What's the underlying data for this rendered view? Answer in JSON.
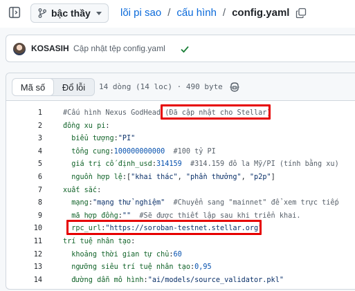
{
  "header": {
    "branch_label": "bậc thầy",
    "breadcrumb": [
      {
        "label": "lõi pi sao"
      },
      {
        "label": "cấu hình"
      }
    ],
    "separator": "/",
    "file_name": "config.yaml"
  },
  "commit": {
    "author": "KOSASIH",
    "message": "Cập nhật tệp config.yaml",
    "status": "success"
  },
  "file": {
    "tabs": [
      "Mã số",
      "Đổ lỗi"
    ],
    "active_tab": "Mã số",
    "info": "14 dòng (14 loc) · 490 byte"
  },
  "code": [
    {
      "n": "1",
      "parts": [
        {
          "t": "#Cấu hình Nexus GodHead ",
          "c": "c"
        },
        {
          "t": "(Đã cập nhật cho Stellar)",
          "c": "c"
        }
      ]
    },
    {
      "n": "2",
      "parts": [
        {
          "t": "đồng xu pi",
          "c": "k"
        },
        {
          "t": ":",
          "c": "p"
        }
      ]
    },
    {
      "n": "3",
      "parts": [
        {
          "t": "  biểu tượng",
          "c": "k"
        },
        {
          "t": ":",
          "c": "p"
        },
        {
          "t": "\"PI\"",
          "c": "s"
        }
      ]
    },
    {
      "n": "4",
      "parts": [
        {
          "t": "  tổng cung",
          "c": "k"
        },
        {
          "t": ":",
          "c": "p"
        },
        {
          "t": "100000000000",
          "c": "n"
        },
        {
          "t": "  #100 tỷ PI",
          "c": "c"
        }
      ]
    },
    {
      "n": "5",
      "parts": [
        {
          "t": "  giá trị cố định_usd",
          "c": "k"
        },
        {
          "t": ":",
          "c": "p"
        },
        {
          "t": "314159",
          "c": "n"
        },
        {
          "t": "  #314.159 đô la Mỹ/PI (tính bằng xu)",
          "c": "c"
        }
      ]
    },
    {
      "n": "6",
      "parts": [
        {
          "t": "  nguồn hợp lệ",
          "c": "k"
        },
        {
          "t": ":[",
          "c": "p"
        },
        {
          "t": "\"khai thác\"",
          "c": "s"
        },
        {
          "t": ", ",
          "c": "p"
        },
        {
          "t": "\"phần thưởng\"",
          "c": "s"
        },
        {
          "t": ", ",
          "c": "p"
        },
        {
          "t": "\"p2p\"",
          "c": "s"
        },
        {
          "t": "]",
          "c": "p"
        }
      ]
    },
    {
      "n": "7",
      "parts": [
        {
          "t": "xuất sắc",
          "c": "k"
        },
        {
          "t": ":",
          "c": "p"
        }
      ]
    },
    {
      "n": "8",
      "parts": [
        {
          "t": "  mạng",
          "c": "k"
        },
        {
          "t": ":",
          "c": "p"
        },
        {
          "t": "\"mạng thử nghiệm\"",
          "c": "s"
        },
        {
          "t": "  #Chuyển sang \"mainnet\" để xem trực tiếp",
          "c": "c"
        }
      ]
    },
    {
      "n": "9",
      "parts": [
        {
          "t": "  mã hợp đồng",
          "c": "k"
        },
        {
          "t": ":",
          "c": "p"
        },
        {
          "t": "\"\"",
          "c": "s"
        },
        {
          "t": "  #Sẽ được thiết lập sau khi triển khai.",
          "c": "c"
        }
      ]
    },
    {
      "n": "10",
      "parts": [
        {
          "t": "  rpc_url",
          "c": "k"
        },
        {
          "t": ":",
          "c": "p"
        },
        {
          "t": "\"https://soroban-testnet.stellar.org\"",
          "c": "s"
        }
      ]
    },
    {
      "n": "11",
      "parts": [
        {
          "t": "trí tuệ nhân tạo",
          "c": "k"
        },
        {
          "t": ":",
          "c": "p"
        }
      ]
    },
    {
      "n": "12",
      "parts": [
        {
          "t": "  khoảng thời gian tự chủ",
          "c": "k"
        },
        {
          "t": ":",
          "c": "p"
        },
        {
          "t": "60",
          "c": "n"
        }
      ]
    },
    {
      "n": "13",
      "parts": [
        {
          "t": "  ngưỡng siêu trí tuệ nhân tạo",
          "c": "k"
        },
        {
          "t": ":",
          "c": "p"
        },
        {
          "t": "0,95",
          "c": "n"
        }
      ]
    },
    {
      "n": "14",
      "parts": [
        {
          "t": "  đường dẫn mô hình",
          "c": "k"
        },
        {
          "t": ":",
          "c": "p"
        },
        {
          "t": "\"ai/models/source_validator.pkl\"",
          "c": "s"
        }
      ]
    }
  ],
  "colors": {
    "link": "#0969da",
    "highlight_box": "#e60000",
    "success": "#1a7f37"
  }
}
